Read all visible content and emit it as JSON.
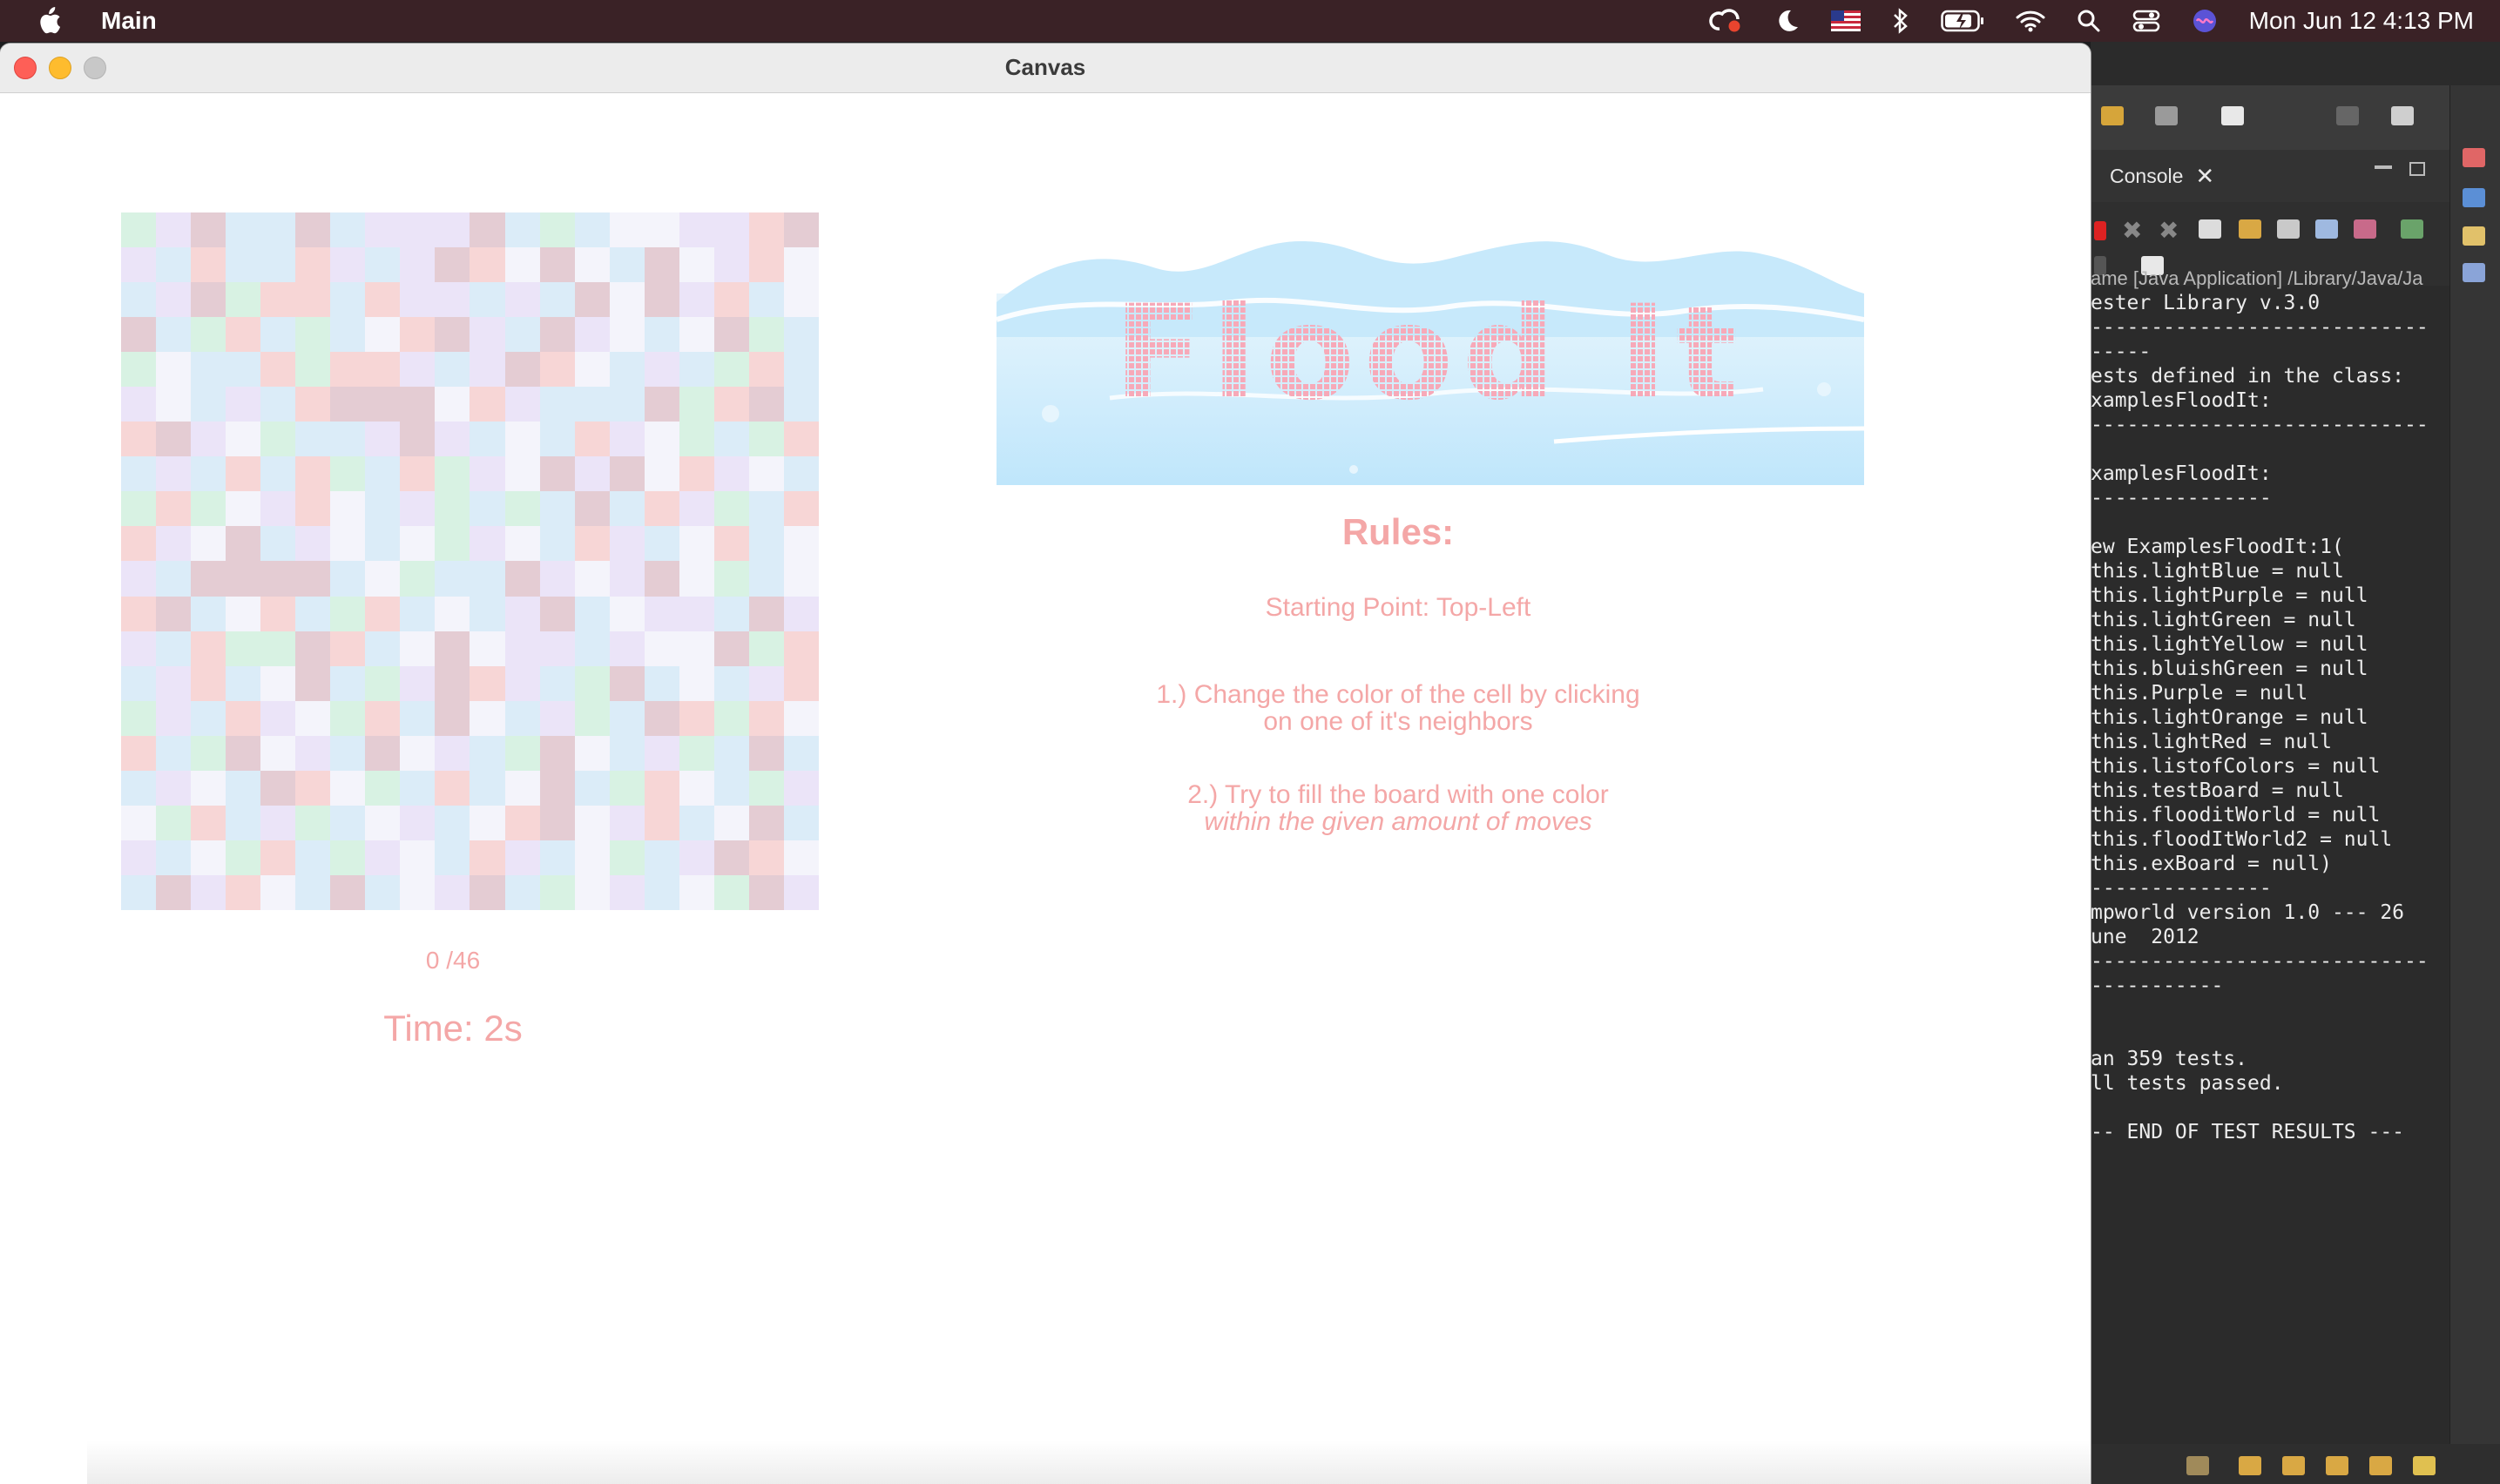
{
  "menubar": {
    "app_name": "Main",
    "clock": "Mon Jun 12  4:13 PM",
    "icons": [
      "apple-icon",
      "creative-cloud-icon",
      "moon-icon",
      "us-flag-icon",
      "bluetooth-icon",
      "battery-icon",
      "wifi-icon",
      "spotlight-search-icon",
      "control-center-icon",
      "siri-icon"
    ]
  },
  "window": {
    "title": "Canvas"
  },
  "game": {
    "moves_text": "0 /46",
    "time_text": "Time: 2s",
    "logo_text": "Flood It",
    "rules_title": "Rules:",
    "starting_point": "Starting Point: Top-Left",
    "rule1_line1": "1.) Change the color of the cell by clicking",
    "rule1_line2": "on one of it's neighbors",
    "rule2_line1": "2.) Try to fill the board with one color",
    "rule2_line2": "within the given amount of moves",
    "palette": {
      "p": "#ebe4f8",
      "b": "#dbecf8",
      "g": "#d8f2e3",
      "w": "#f4f4fb",
      "r": "#f7d6d6",
      "d": "#e4ccd3"
    },
    "board_rows": [
      "gpdbbdbpppdbgbwwpprd",
      "pbrbbrpbpdrwdwbdwprw",
      "bpdgrrbrppbpbdwdprbw",
      "dbgrbgbwrdpbdpwbwdgb",
      "gwbbrgrrpbpdrwbpbgrb",
      "pwbpbrdddwrpbbbdgrdb",
      "rdpwgbbpdpbwbrpwgbgr",
      "bpbrbrgbrgpwdpdwrpwb",
      "grgwprwbpgbgbdbrpgbr",
      "rpwdbpwbwgpwbrpbwrbw",
      "pbddddbwgbbdpwpdwgbw",
      "rdbwrbgrbwbpdbwppbdp",
      "pbrggdrbwdwppbpwwdgr",
      "bprbwdbgpdrpbgdbwbpr",
      "gpbrpwgrbdwbpgbdrgrw",
      "rbgdwpbdwpbgdwbpgbdb",
      "bpwbdrwgbrbwdbgrwbgp",
      "wgrbpgbwpbwrdwprbwdb",
      "pbwgrbgpwbrpbwgbpdrw",
      "bdprwbdbwpdbgwpbwgdp"
    ]
  },
  "console": {
    "tab_label": "Console",
    "header": "ame [Java Application] /Library/Java/Ja",
    "lines": [
      "ester Library v.3.0",
      "----------------------------",
      "-----",
      "ests defined in the class:",
      "xamplesFloodIt:",
      "----------------------------",
      "",
      "xamplesFloodIt:",
      "---------------",
      "",
      "ew ExamplesFloodIt:1(",
      "this.lightBlue = null",
      "this.lightPurple = null",
      "this.lightGreen = null",
      "this.lightYellow = null",
      "this.bluishGreen = null",
      "this.Purple = null",
      "this.lightOrange = null",
      "this.lightRed = null",
      "this.listofColors = null",
      "this.testBoard = null",
      "this.flooditWorld = null",
      "this.floodItWorld2 = null",
      "this.exBoard = null)",
      "---------------",
      "mpworld version 1.0 --- 26",
      "une  2012",
      "----------------------------",
      "-----------",
      "",
      "",
      "an 359 tests.",
      "ll tests passed.",
      "",
      "-- END OF TEST RESULTS ---"
    ]
  }
}
